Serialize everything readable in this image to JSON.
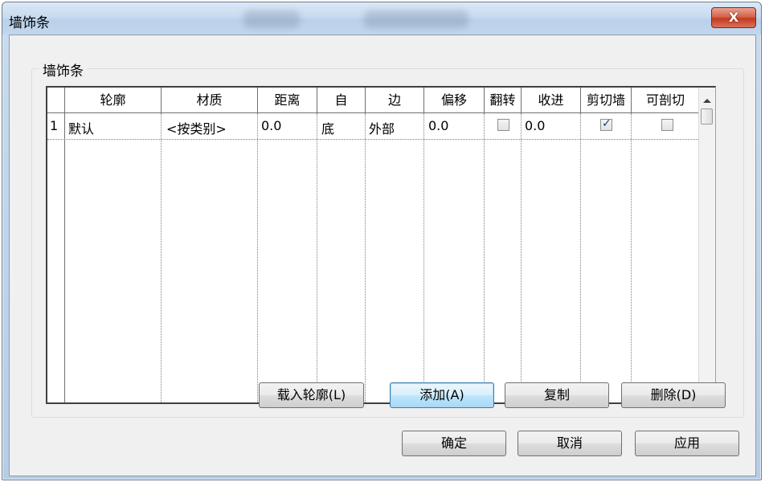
{
  "window": {
    "title": "墙饰条",
    "close_label": "X"
  },
  "group": {
    "label": "墙饰条"
  },
  "table": {
    "headers": [
      "轮廓",
      "材质",
      "距离",
      "自",
      "边",
      "偏移",
      "翻转",
      "收进",
      "剪切墙",
      "可剖切"
    ],
    "rows": [
      {
        "index": "1",
        "profile": "默认",
        "material": "<按类别>",
        "distance": "0.0",
        "from": "底",
        "side": "外部",
        "offset": "0.0",
        "flip": false,
        "setback": "0.0",
        "cuts_wall": true,
        "cuttable": false
      }
    ]
  },
  "buttons": {
    "load_profile": "载入轮廓(L)",
    "add": "添加(A)",
    "copy": "复制",
    "delete": "删除(D)",
    "ok": "确定",
    "cancel": "取消",
    "apply": "应用"
  },
  "colors": {
    "default_button_border": "#3c7fb1",
    "close_button": "#c23a21"
  }
}
